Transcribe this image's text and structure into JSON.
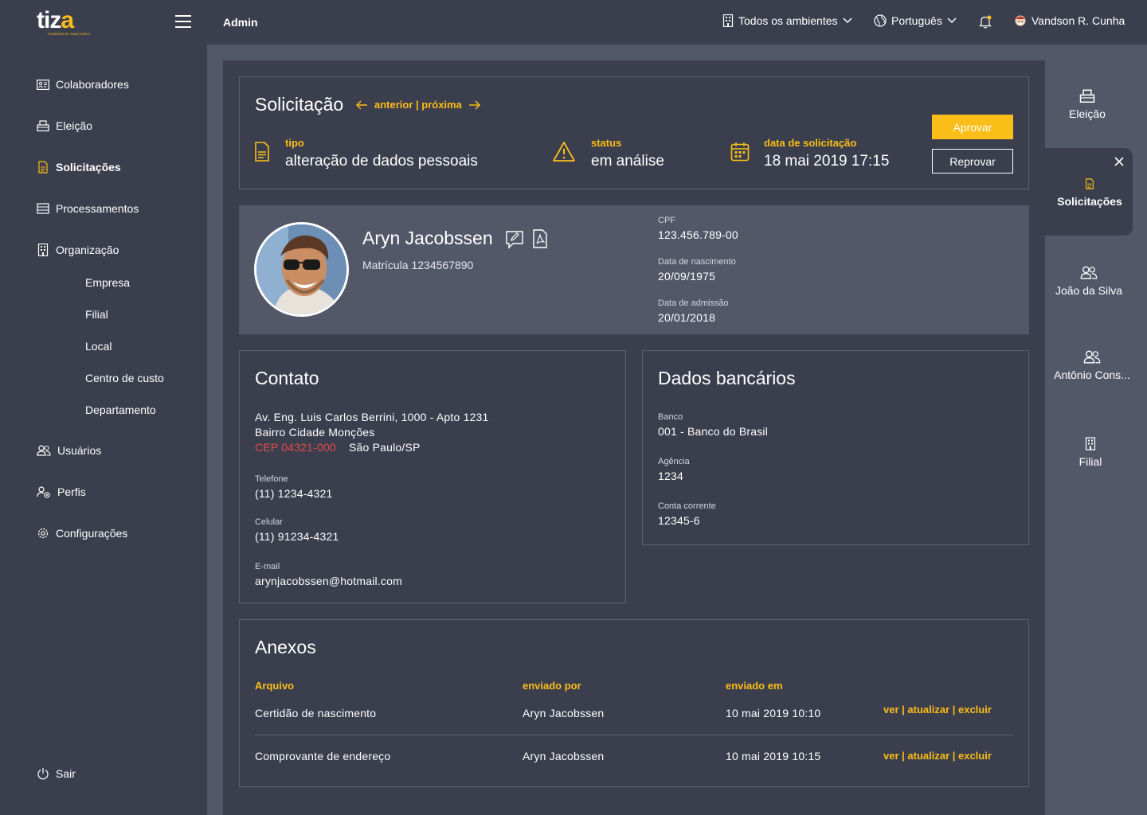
{
  "topbar": {
    "logo_text": "tiza",
    "logo_tagline": "POWERED BY SANCTOBOX",
    "admin_label": "Admin",
    "environments": "Todos os ambientes",
    "language": "Português",
    "user_name": "Vandson R. Cunha"
  },
  "sidebar": {
    "items": [
      {
        "label": "Colaboradores",
        "icon": "id-card-icon"
      },
      {
        "label": "Eleição",
        "icon": "ballot-box-icon"
      },
      {
        "label": "Solicitações",
        "icon": "document-icon"
      },
      {
        "label": "Processamentos",
        "icon": "list-icon"
      },
      {
        "label": "Organização",
        "icon": "building-icon"
      },
      {
        "label": "Usuários",
        "icon": "users-icon"
      },
      {
        "label": "Perfis",
        "icon": "user-gear-icon"
      },
      {
        "label": "Configurações",
        "icon": "gear-icon"
      }
    ],
    "sub_items": [
      "Empresa",
      "Filial",
      "Local",
      "Centro de custo",
      "Departamento"
    ],
    "logout": "Sair"
  },
  "request": {
    "title": "Solicitação",
    "nav": "anterior | próxima",
    "type_label": "tipo",
    "type_value": "alteração de dados pessoais",
    "status_label": "status",
    "status_value": "em análise",
    "date_label": "data de solicitação",
    "date_value": "18 mai 2019 17:15",
    "approve": "Aprovar",
    "reject": "Reprovar"
  },
  "profile": {
    "name": "Aryn Jacobssen",
    "registration": "Matrícula 1234567890",
    "cpf_label": "CPF",
    "cpf": "123.456.789-00",
    "birth_label": "Data de nascimento",
    "birth": "20/09/1975",
    "admission_label": "Data de admissão",
    "admission": "20/01/2018"
  },
  "contact": {
    "title": "Contato",
    "address1": "Av. Eng. Luis Carlos Berrini, 1000 - Apto 1231",
    "address2": "Bairro Cidade Monções",
    "cep": "CEP 04321-000",
    "city": "São Paulo/SP",
    "phone_label": "Telefone",
    "phone": "(11) 1234-4321",
    "mobile_label": "Celular",
    "mobile": "(11) 91234-4321",
    "email_label": "E-mail",
    "email": "arynjacobssen@hotmail.com"
  },
  "bank": {
    "title": "Dados bancários",
    "bank_label": "Banco",
    "bank": "001 - Banco do Brasil",
    "agency_label": "Agência",
    "agency": "1234",
    "account_label": "Conta corrente",
    "account": "12345-6"
  },
  "attachments": {
    "title": "Anexos",
    "headers": [
      "Arquivo",
      "enviado por",
      "enviado em"
    ],
    "rows": [
      {
        "file": "Certidão de nascimento",
        "sent_by": "Aryn Jacobssen",
        "sent_at": "10 mai 2019 10:10",
        "actions": "ver | atualizar | excluir"
      },
      {
        "file": "Comprovante de endereço",
        "sent_by": "Aryn Jacobssen",
        "sent_at": "10 mai 2019 10:15",
        "actions": "ver | atualizar | excluir"
      }
    ]
  },
  "right_rail": {
    "items": [
      "Eleição",
      "Solicitações",
      "João da Silva",
      "Antônio Cons...",
      "Filial"
    ]
  },
  "colors": {
    "accent": "#fbbd17",
    "background": "#3b3f4d",
    "panel": "#535869",
    "cep": "#e5484d"
  }
}
